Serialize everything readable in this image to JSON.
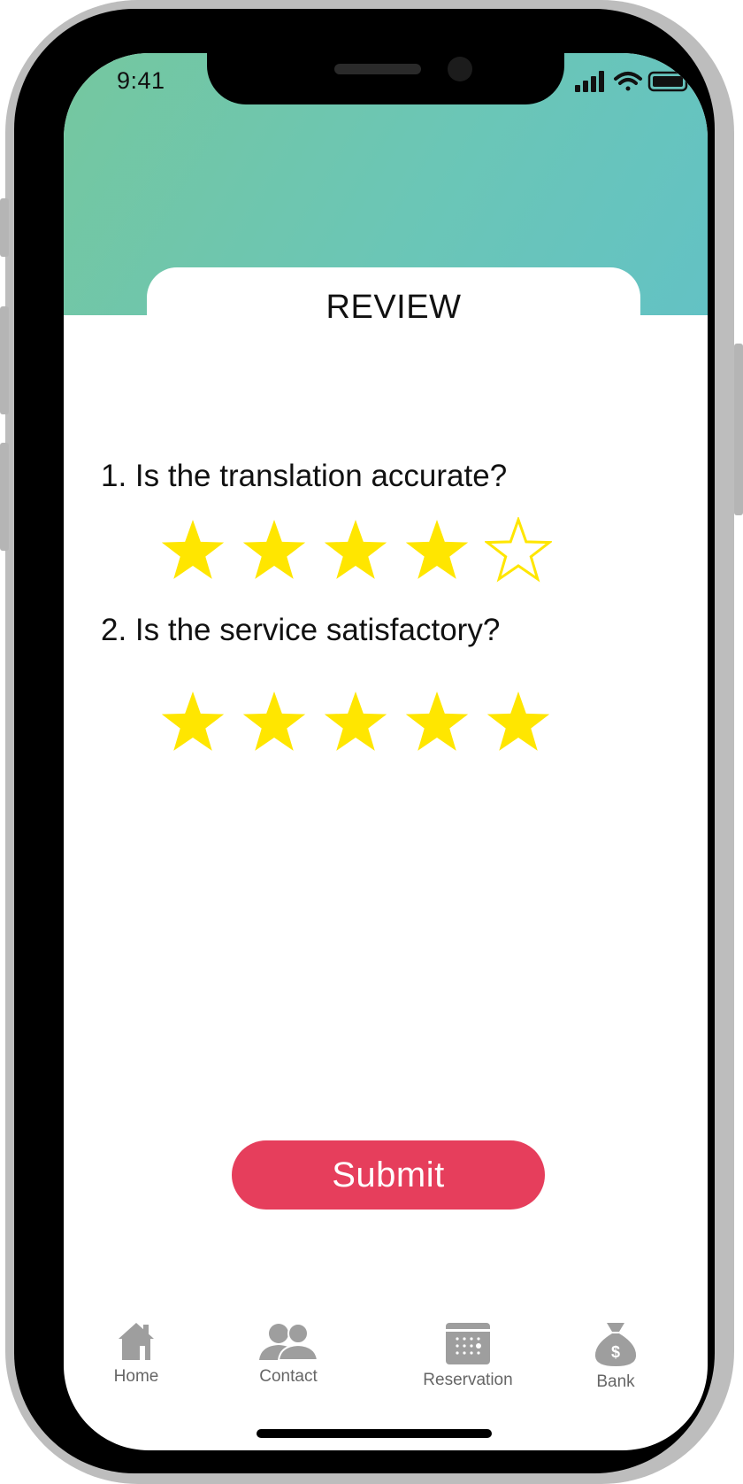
{
  "status_bar": {
    "time": "9:41"
  },
  "review": {
    "title": "REVIEW",
    "questions": [
      {
        "label": "1. Is the translation accurate?",
        "rating": 4,
        "max": 5
      },
      {
        "label": "2. Is the service satisfactory?",
        "rating": 5,
        "max": 5
      }
    ],
    "submit_label": "Submit"
  },
  "nav": {
    "items": [
      {
        "label": "Home",
        "icon": "home-icon"
      },
      {
        "label": "Contact",
        "icon": "contacts-icon"
      },
      {
        "label": "Reservation",
        "icon": "calendar-icon"
      },
      {
        "label": "Bank",
        "icon": "money-bag-icon"
      }
    ]
  },
  "colors": {
    "header_gradient_start": "#75c79f",
    "header_gradient_end": "#63c2c4",
    "star": "#ffe600",
    "submit": "#e63e5c",
    "nav_icon": "#9e9e9e"
  }
}
